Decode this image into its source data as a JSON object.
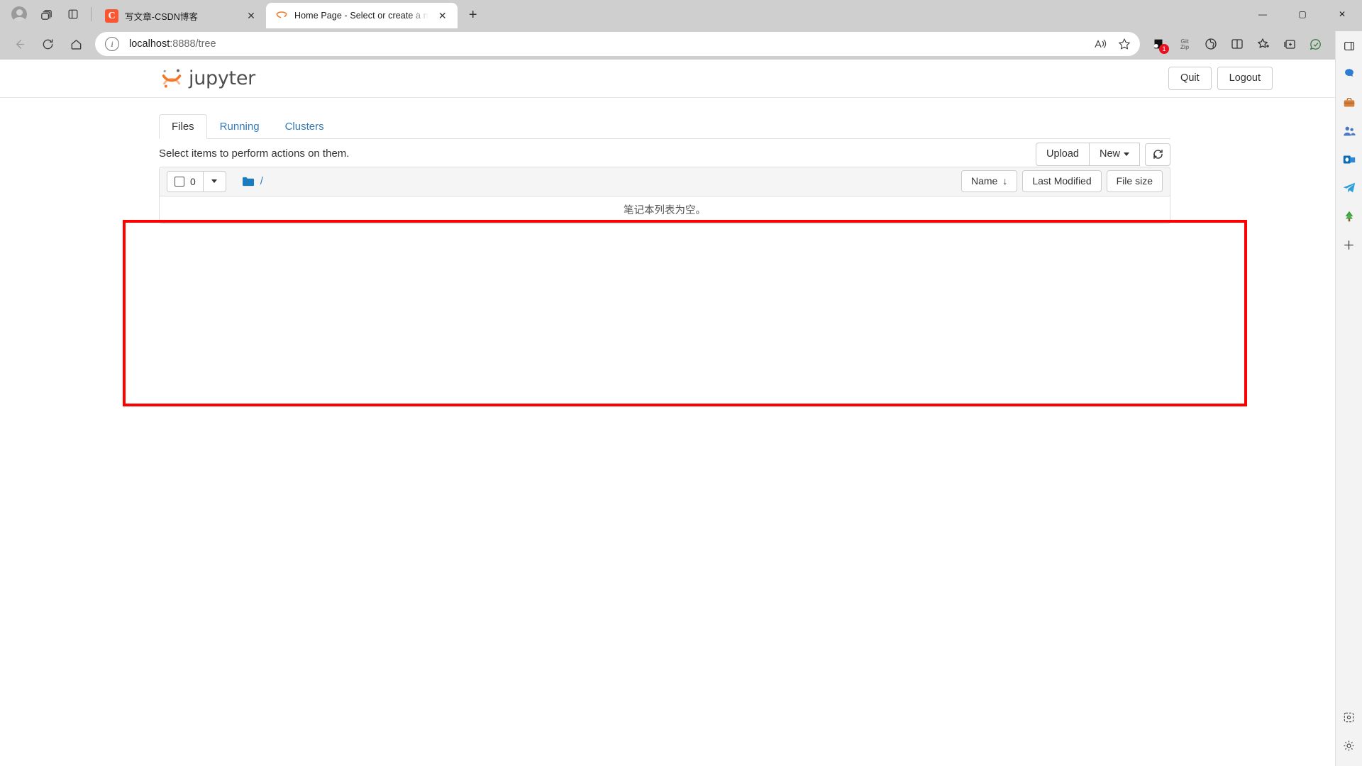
{
  "browser": {
    "name": "Microsoft Edge",
    "tabs": [
      {
        "title": "写文章-CSDN博客",
        "favicon": "csdn-favicon",
        "active": false,
        "close_label": "✕"
      },
      {
        "title": "Home Page - Select or create a n",
        "favicon": "jupyter-favicon",
        "active": true,
        "close_label": "✕"
      }
    ],
    "new_tab_label": "+",
    "titlebar_icons": [
      "profile-avatar-icon",
      "workspaces-icon",
      "tab-actions-icon"
    ],
    "window_controls": {
      "minimize": "—",
      "maximize": "▢",
      "close": "✕"
    },
    "nav": {
      "back": "back-arrow-icon",
      "refresh": "refresh-icon",
      "home": "home-icon"
    },
    "address": {
      "info_icon": "i",
      "host": "localhost",
      "path": ":8888/tree",
      "full_url": "localhost:8888/tree",
      "read_aloud": "read-aloud-icon",
      "favorite": "star-icon"
    },
    "toolbar_icons": [
      {
        "name": "extension-dark-icon",
        "badge": "1"
      },
      {
        "name": "gitzip-icon",
        "line1": "Git",
        "line2": "Zip"
      },
      {
        "name": "browser-essentials-icon",
        "badge": ""
      },
      {
        "name": "split-screen-icon",
        "badge": ""
      },
      {
        "name": "favorites-icon",
        "badge": ""
      },
      {
        "name": "collections-icon",
        "badge": ""
      },
      {
        "name": "copilot-icon",
        "badge": ""
      },
      {
        "name": "settings-more-icon",
        "badge": ""
      }
    ],
    "sidebar_icons": [
      "sidebar-expand-icon",
      "copilot-sidebar-icon",
      "shopping-icon",
      "search-sidebar-icon",
      "outlook-icon",
      "telegram-icon",
      "tree-icon",
      "add-sidebar-icon",
      "customize-sidebar-icon",
      "sidebar-settings-icon"
    ]
  },
  "jupyter": {
    "logo_text": "jupyter",
    "header_buttons": [
      {
        "label": "Quit",
        "name": "quit-button"
      },
      {
        "label": "Logout",
        "name": "logout-button"
      }
    ],
    "tabs": [
      {
        "label": "Files",
        "active": true
      },
      {
        "label": "Running",
        "active": false
      },
      {
        "label": "Clusters",
        "active": false
      }
    ],
    "select_note": "Select items to perform actions on them.",
    "toolbar": {
      "upload": "Upload",
      "new": "New",
      "new_caret": "▾",
      "refresh": "refresh-icon"
    },
    "list_header": {
      "checkbox_count": "0",
      "checkbox_caret": "▾",
      "breadcrumb_root": "/",
      "folder_icon": "folder-icon",
      "sort_buttons": [
        {
          "label": "Name",
          "arrow": "↓",
          "name": "sort-name-button"
        },
        {
          "label": "Last Modified",
          "arrow": "",
          "name": "sort-last-modified-button"
        },
        {
          "label": "File size",
          "arrow": "",
          "name": "sort-file-size-button"
        }
      ]
    },
    "empty_message": "笔记本列表为空。"
  },
  "annotation": {
    "type": "red-rectangle-highlight",
    "color": "#ff0000"
  }
}
